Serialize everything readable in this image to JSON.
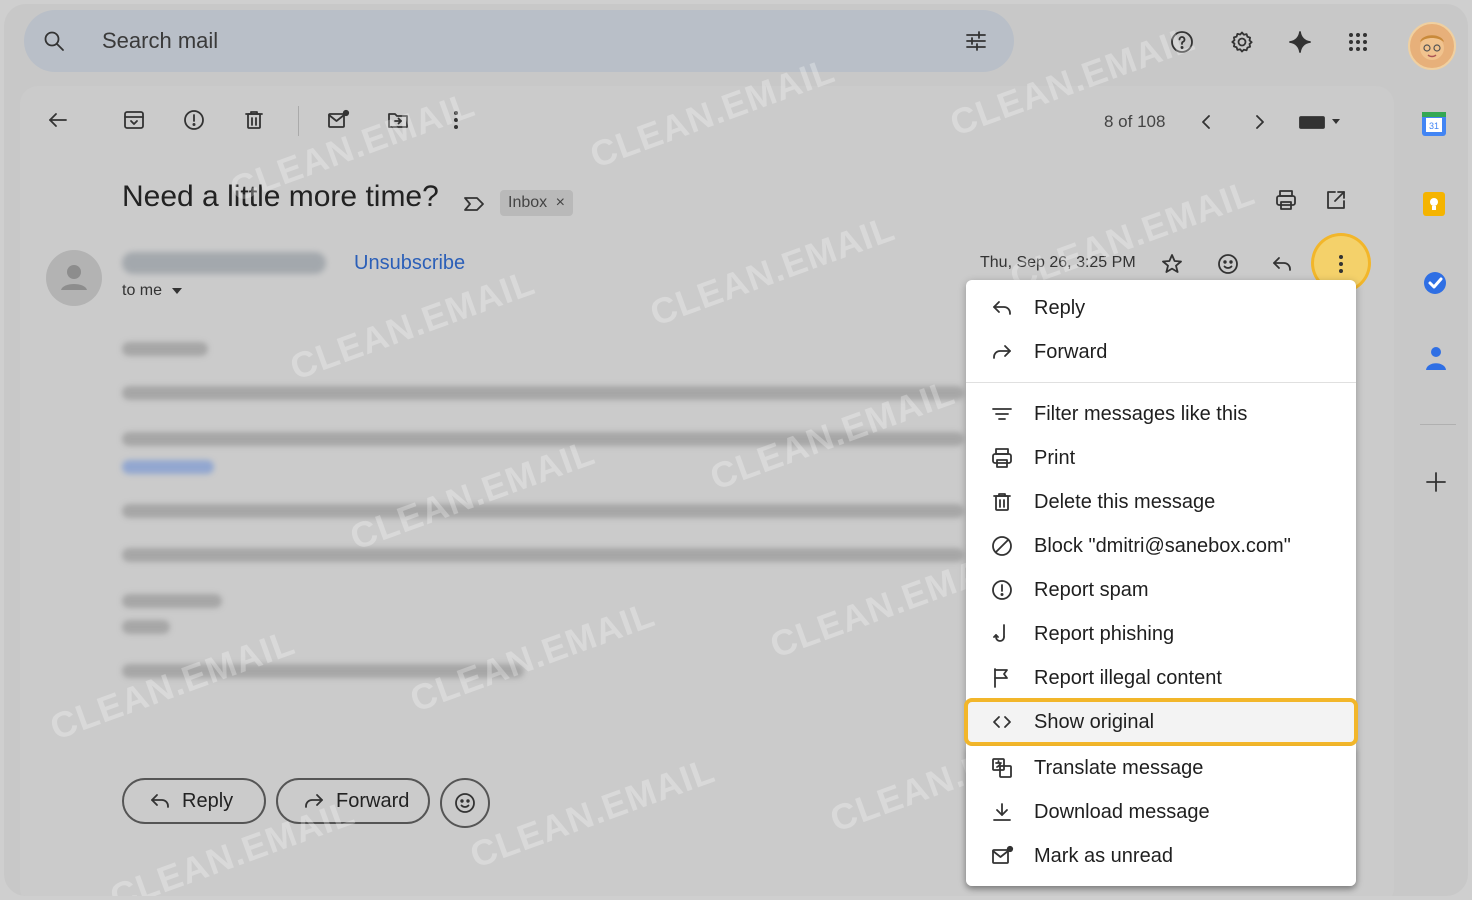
{
  "search": {
    "placeholder": "Search mail"
  },
  "toolbar": {
    "counter": "8 of 108"
  },
  "email": {
    "subject": "Need a little more time?",
    "label": "Inbox",
    "label_remove": "×",
    "unsubscribe": "Unsubscribe",
    "recipient": "to me",
    "date": "Thu, Sep 26, 3:25 PM"
  },
  "actions": {
    "reply": "Reply",
    "forward": "Forward"
  },
  "menu": {
    "items": [
      {
        "label": "Reply",
        "icon": "reply-icon"
      },
      {
        "label": "Forward",
        "icon": "forward-icon"
      },
      {
        "label": "Filter messages like this",
        "icon": "filter-icon"
      },
      {
        "label": "Print",
        "icon": "print-icon"
      },
      {
        "label": "Delete this message",
        "icon": "trash-icon"
      },
      {
        "label": "Block \"dmitri@sanebox.com\"",
        "icon": "block-icon"
      },
      {
        "label": "Report spam",
        "icon": "spam-icon"
      },
      {
        "label": "Report phishing",
        "icon": "phishing-hook-icon"
      },
      {
        "label": "Report illegal content",
        "icon": "flag-icon"
      },
      {
        "label": "Show original",
        "icon": "code-icon"
      },
      {
        "label": "Translate message",
        "icon": "translate-icon"
      },
      {
        "label": "Download message",
        "icon": "download-icon"
      },
      {
        "label": "Mark as unread",
        "icon": "mark-unread-icon"
      }
    ]
  },
  "watermark": "CLEAN.EMAIL",
  "colors": {
    "highlight": "#f2b62a",
    "link": "#2b5fb8",
    "menu_bg": "#ffffff"
  }
}
